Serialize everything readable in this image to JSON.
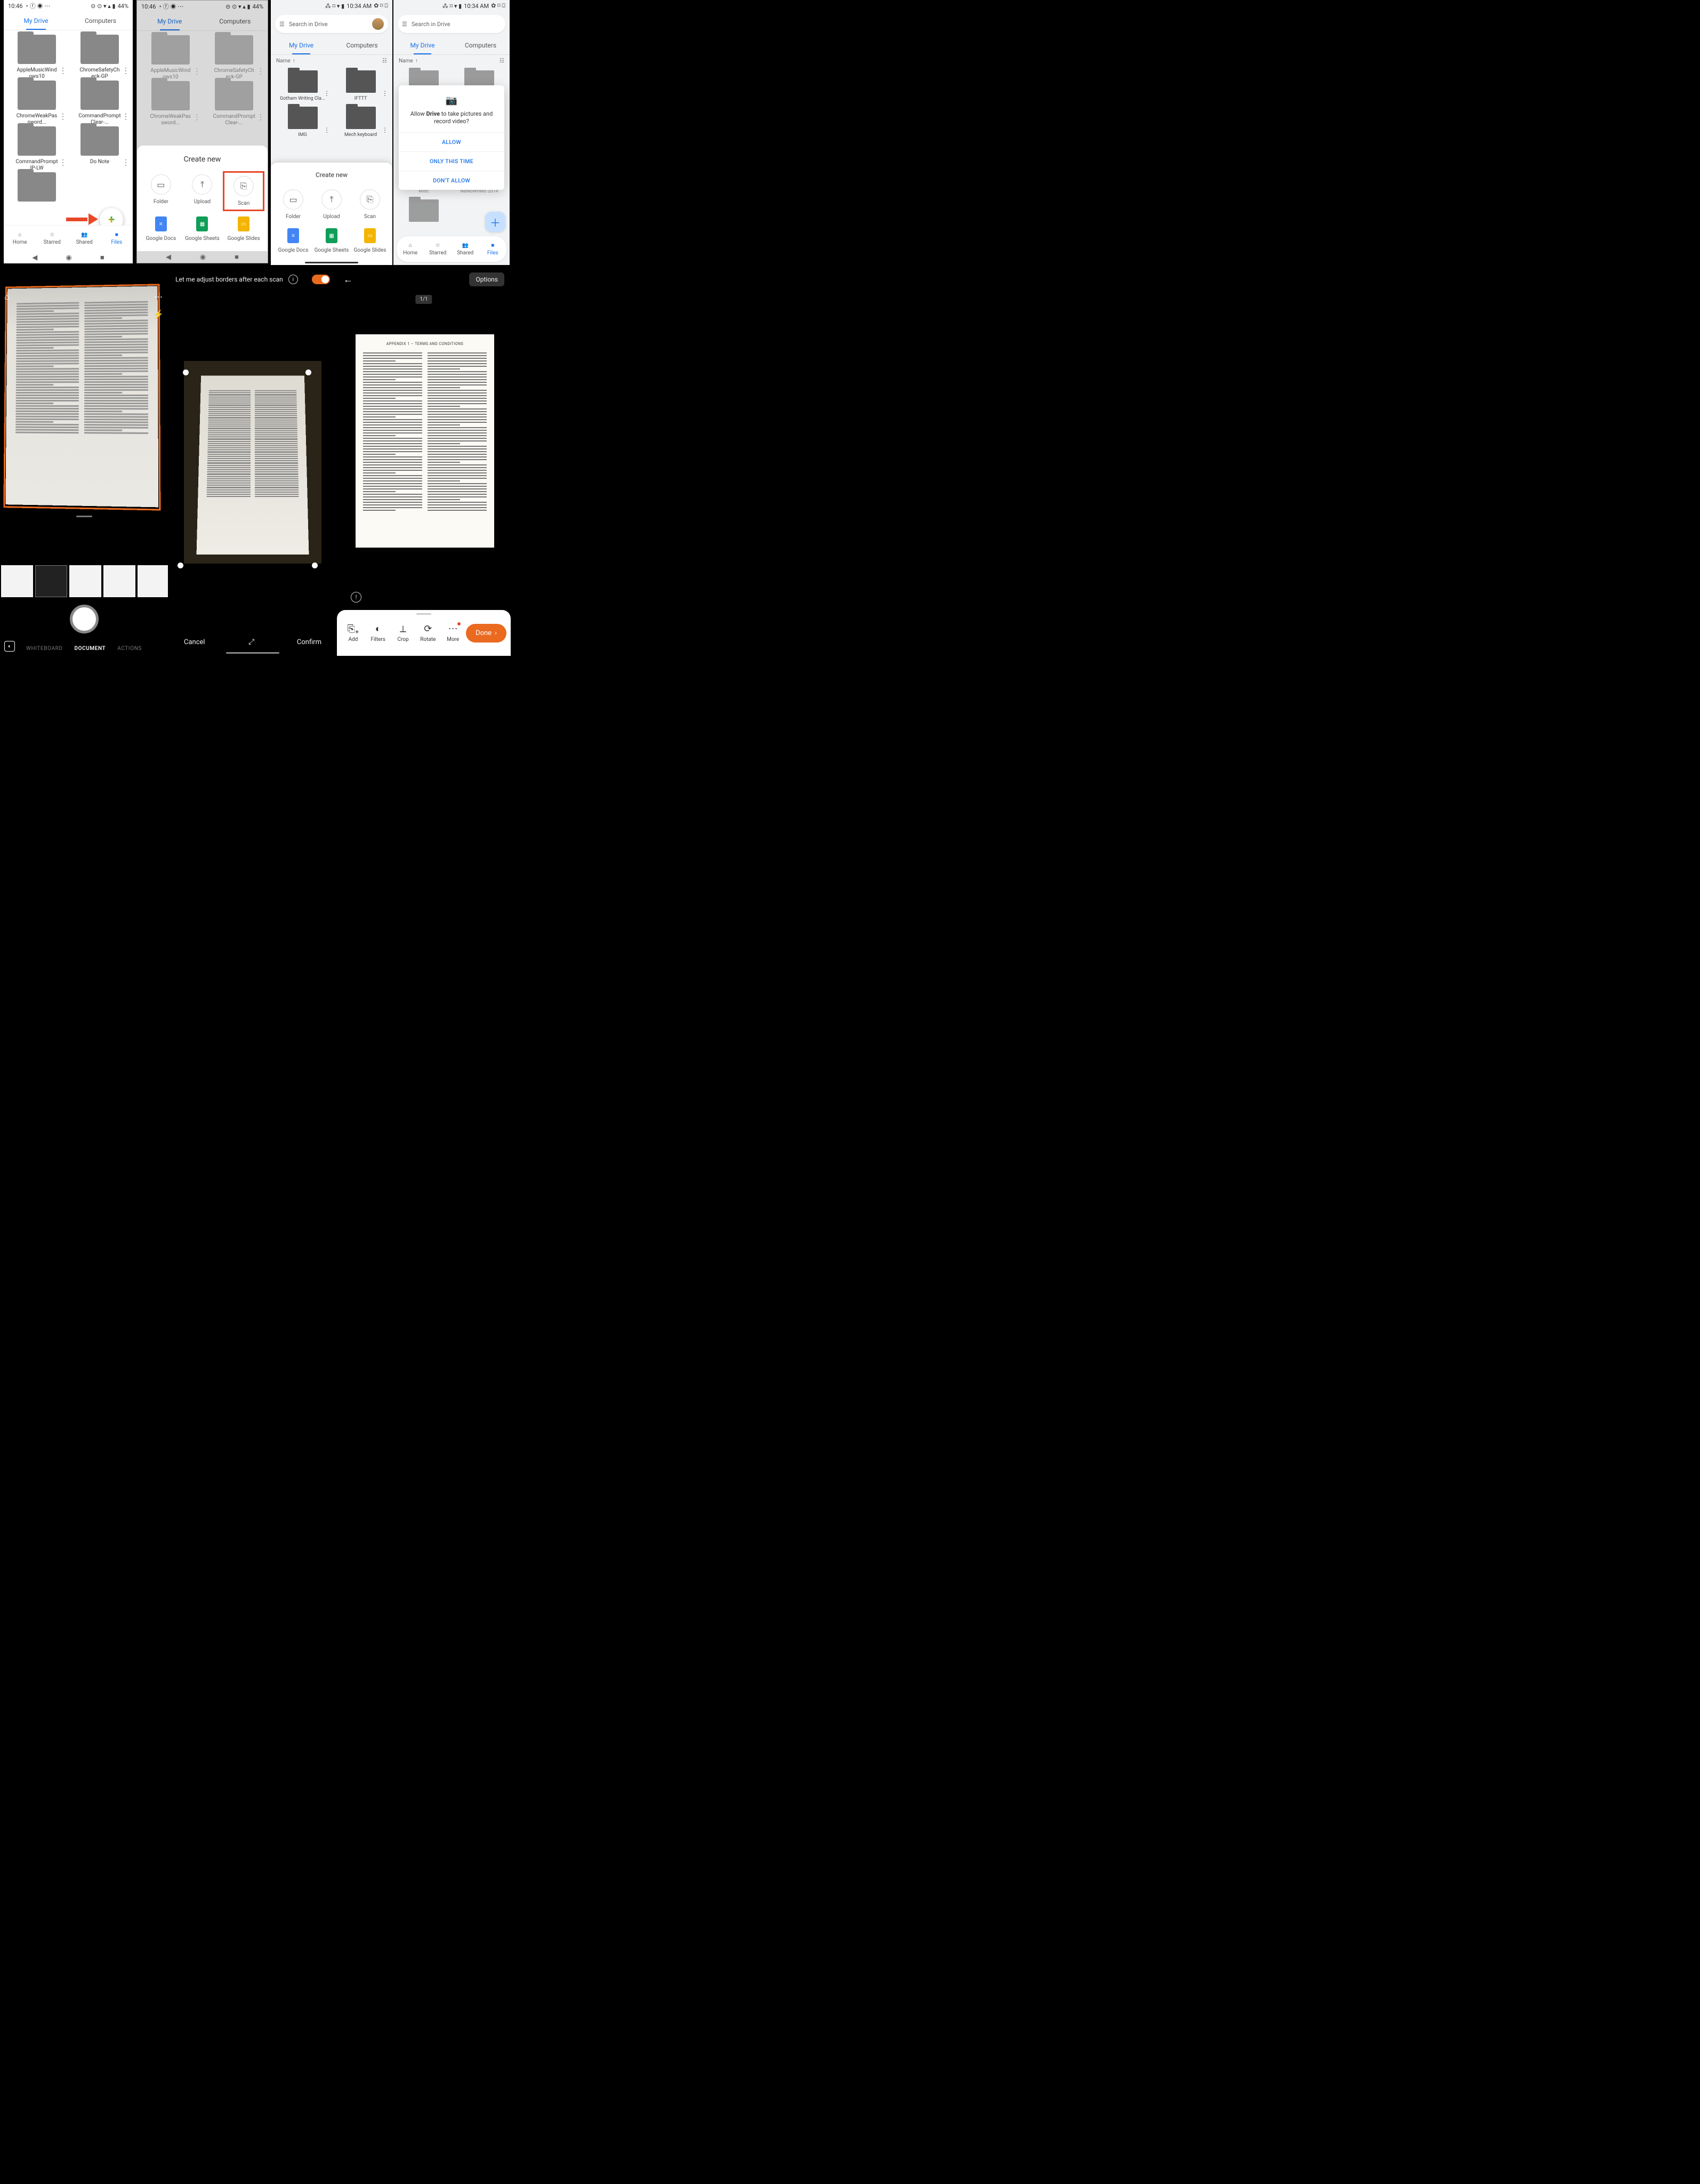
{
  "status": {
    "time1": "10:46",
    "battery1": "44%",
    "time2": "10:34 AM"
  },
  "tabs": {
    "my_drive": "My Drive",
    "computers": "Computers"
  },
  "p1_folders": [
    "AppleMusicWindows10",
    "ChromeSafetyCheck-GP",
    "ChromeWeakPassword...",
    "CommandPromptClear-...",
    "CommandPromptIP-LW",
    "Do Note"
  ],
  "bottom_nav": {
    "home": "Home",
    "starred": "Starred",
    "shared": "Shared",
    "files": "Files"
  },
  "create_new": {
    "title": "Create new",
    "folder": "Folder",
    "upload": "Upload",
    "scan": "Scan",
    "docs": "Google Docs",
    "sheets": "Google Sheets",
    "slides": "Google Slides"
  },
  "search_placeholder": "Search in Drive",
  "name_header": "Name",
  "p3_folders": [
    "Gotham Writing Cla...",
    "IFTTT",
    "IMG",
    "Mech keyboard"
  ],
  "p4_folders": [
    "Misc",
    "NaNoWriMo 2014"
  ],
  "permission": {
    "text_prefix": "Allow ",
    "app": "Drive",
    "text_suffix": " to take pictures and record video?",
    "allow": "ALLOW",
    "only_this_time": "ONLY THIS TIME",
    "dont_allow": "DON'T ALLOW"
  },
  "camera": {
    "modes": {
      "whiteboard": "WHITEBOARD",
      "document": "DOCUMENT",
      "actions": "ACTIONS"
    }
  },
  "adjust": {
    "label": "Let me adjust borders after each scan",
    "cancel": "Cancel",
    "confirm": "Confirm"
  },
  "result": {
    "options": "Options",
    "page": "1/1",
    "doc_title": "APPENDIX 1 – TERMS AND CONDITIONS",
    "add": "Add",
    "filters": "Filters",
    "crop": "Crop",
    "rotate": "Rotate",
    "more": "More",
    "done": "Done"
  }
}
